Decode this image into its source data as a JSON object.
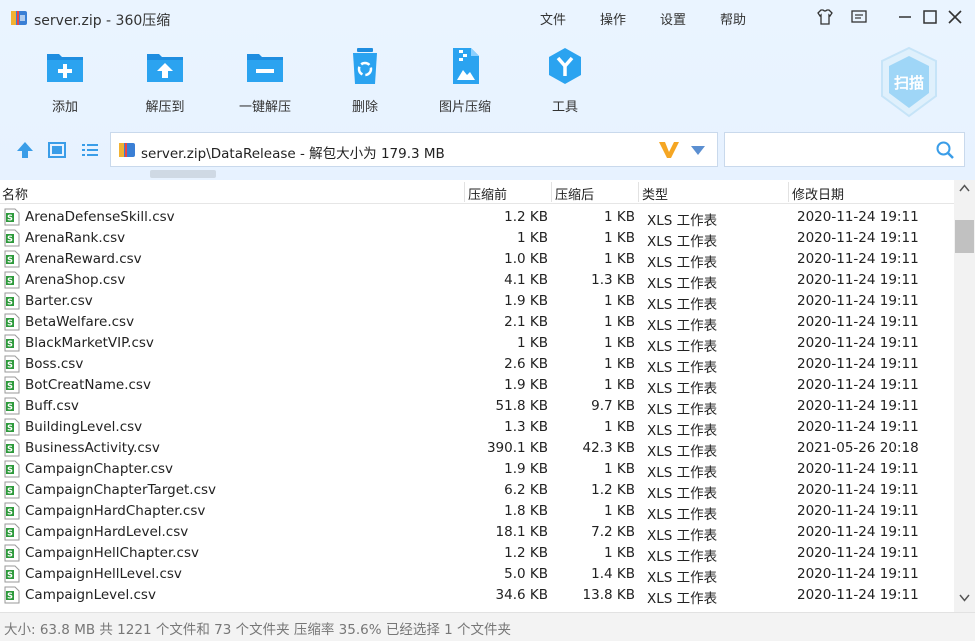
{
  "window": {
    "title": "server.zip - 360压缩",
    "menu": [
      "文件",
      "操作",
      "设置",
      "帮助"
    ]
  },
  "toolbar": {
    "items": [
      {
        "label": "添加",
        "icon": "add-icon"
      },
      {
        "label": "解压到",
        "icon": "extract-to-icon"
      },
      {
        "label": "一键解压",
        "icon": "one-click-extract-icon"
      },
      {
        "label": "删除",
        "icon": "delete-icon"
      },
      {
        "label": "图片压缩",
        "icon": "image-compress-icon"
      },
      {
        "label": "工具",
        "icon": "tools-icon"
      }
    ],
    "scan_label": "扫描"
  },
  "address": {
    "path": "server.zip\\DataRelease - 解包大小为 179.3 MB"
  },
  "search": {
    "placeholder": ""
  },
  "list": {
    "columns": {
      "name": "名称",
      "original": "压缩前",
      "compressed": "压缩后",
      "type": "类型",
      "modified": "修改日期"
    },
    "rows": [
      {
        "name": "ArenaDefenseSkill.csv",
        "original": "1.2 KB",
        "compressed": "1 KB",
        "type": "XLS 工作表",
        "modified": "2020-11-24 19:11"
      },
      {
        "name": "ArenaRank.csv",
        "original": "1 KB",
        "compressed": "1 KB",
        "type": "XLS 工作表",
        "modified": "2020-11-24 19:11"
      },
      {
        "name": "ArenaReward.csv",
        "original": "1.0 KB",
        "compressed": "1 KB",
        "type": "XLS 工作表",
        "modified": "2020-11-24 19:11"
      },
      {
        "name": "ArenaShop.csv",
        "original": "4.1 KB",
        "compressed": "1.3 KB",
        "type": "XLS 工作表",
        "modified": "2020-11-24 19:11"
      },
      {
        "name": "Barter.csv",
        "original": "1.9 KB",
        "compressed": "1 KB",
        "type": "XLS 工作表",
        "modified": "2020-11-24 19:11"
      },
      {
        "name": "BetaWelfare.csv",
        "original": "2.1 KB",
        "compressed": "1 KB",
        "type": "XLS 工作表",
        "modified": "2020-11-24 19:11"
      },
      {
        "name": "BlackMarketVIP.csv",
        "original": "1 KB",
        "compressed": "1 KB",
        "type": "XLS 工作表",
        "modified": "2020-11-24 19:11"
      },
      {
        "name": "Boss.csv",
        "original": "2.6 KB",
        "compressed": "1 KB",
        "type": "XLS 工作表",
        "modified": "2020-11-24 19:11"
      },
      {
        "name": "BotCreatName.csv",
        "original": "1.9 KB",
        "compressed": "1 KB",
        "type": "XLS 工作表",
        "modified": "2020-11-24 19:11"
      },
      {
        "name": "Buff.csv",
        "original": "51.8 KB",
        "compressed": "9.7 KB",
        "type": "XLS 工作表",
        "modified": "2020-11-24 19:11"
      },
      {
        "name": "BuildingLevel.csv",
        "original": "1.3 KB",
        "compressed": "1 KB",
        "type": "XLS 工作表",
        "modified": "2020-11-24 19:11"
      },
      {
        "name": "BusinessActivity.csv",
        "original": "390.1 KB",
        "compressed": "42.3 KB",
        "type": "XLS 工作表",
        "modified": "2021-05-26 20:18"
      },
      {
        "name": "CampaignChapter.csv",
        "original": "1.9 KB",
        "compressed": "1 KB",
        "type": "XLS 工作表",
        "modified": "2020-11-24 19:11"
      },
      {
        "name": "CampaignChapterTarget.csv",
        "original": "6.2 KB",
        "compressed": "1.2 KB",
        "type": "XLS 工作表",
        "modified": "2020-11-24 19:11"
      },
      {
        "name": "CampaignHardChapter.csv",
        "original": "1.8 KB",
        "compressed": "1 KB",
        "type": "XLS 工作表",
        "modified": "2020-11-24 19:11"
      },
      {
        "name": "CampaignHardLevel.csv",
        "original": "18.1 KB",
        "compressed": "7.2 KB",
        "type": "XLS 工作表",
        "modified": "2020-11-24 19:11"
      },
      {
        "name": "CampaignHellChapter.csv",
        "original": "1.2 KB",
        "compressed": "1 KB",
        "type": "XLS 工作表",
        "modified": "2020-11-24 19:11"
      },
      {
        "name": "CampaignHellLevel.csv",
        "original": "5.0 KB",
        "compressed": "1.4 KB",
        "type": "XLS 工作表",
        "modified": "2020-11-24 19:11"
      },
      {
        "name": "CampaignLevel.csv",
        "original": "34.6 KB",
        "compressed": "13.8 KB",
        "type": "XLS 工作表",
        "modified": "2020-11-24 19:11"
      }
    ]
  },
  "status": {
    "text": "大小: 63.8 MB 共 1221 个文件和 73 个文件夹 压缩率 35.6% 已经选择 1 个文件夹"
  },
  "colors": {
    "accent": "#1aa0e8",
    "background": "#e6f2ff",
    "csv_icon": "#2e9a3c"
  }
}
